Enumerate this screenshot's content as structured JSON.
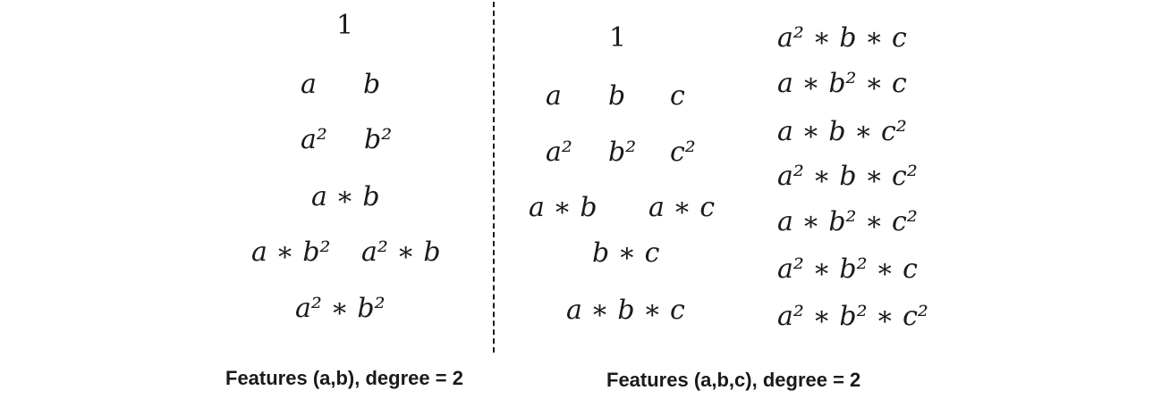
{
  "left_panel": {
    "terms": [
      "1",
      "a",
      "b",
      "a²",
      "b²",
      "a ∗ b",
      "a ∗ b²",
      "a² ∗ b",
      "a² ∗ b²"
    ],
    "caption": "Features (a,b), degree = 2"
  },
  "right_panel": {
    "terms": [
      "1",
      "a",
      "b",
      "c",
      "a²",
      "b²",
      "c²",
      "a ∗ b",
      "a ∗ c",
      "b ∗ c",
      "a ∗ b ∗ c"
    ],
    "terms_col2": [
      "a² ∗ b ∗ c",
      "a ∗ b² ∗ c",
      "a ∗ b ∗ c²",
      "a² ∗ b ∗ c²",
      "a ∗ b² ∗ c²",
      "a² ∗ b² ∗ c",
      "a² ∗ b² ∗ c²"
    ],
    "caption": "Features (a,b,c), degree = 2"
  }
}
